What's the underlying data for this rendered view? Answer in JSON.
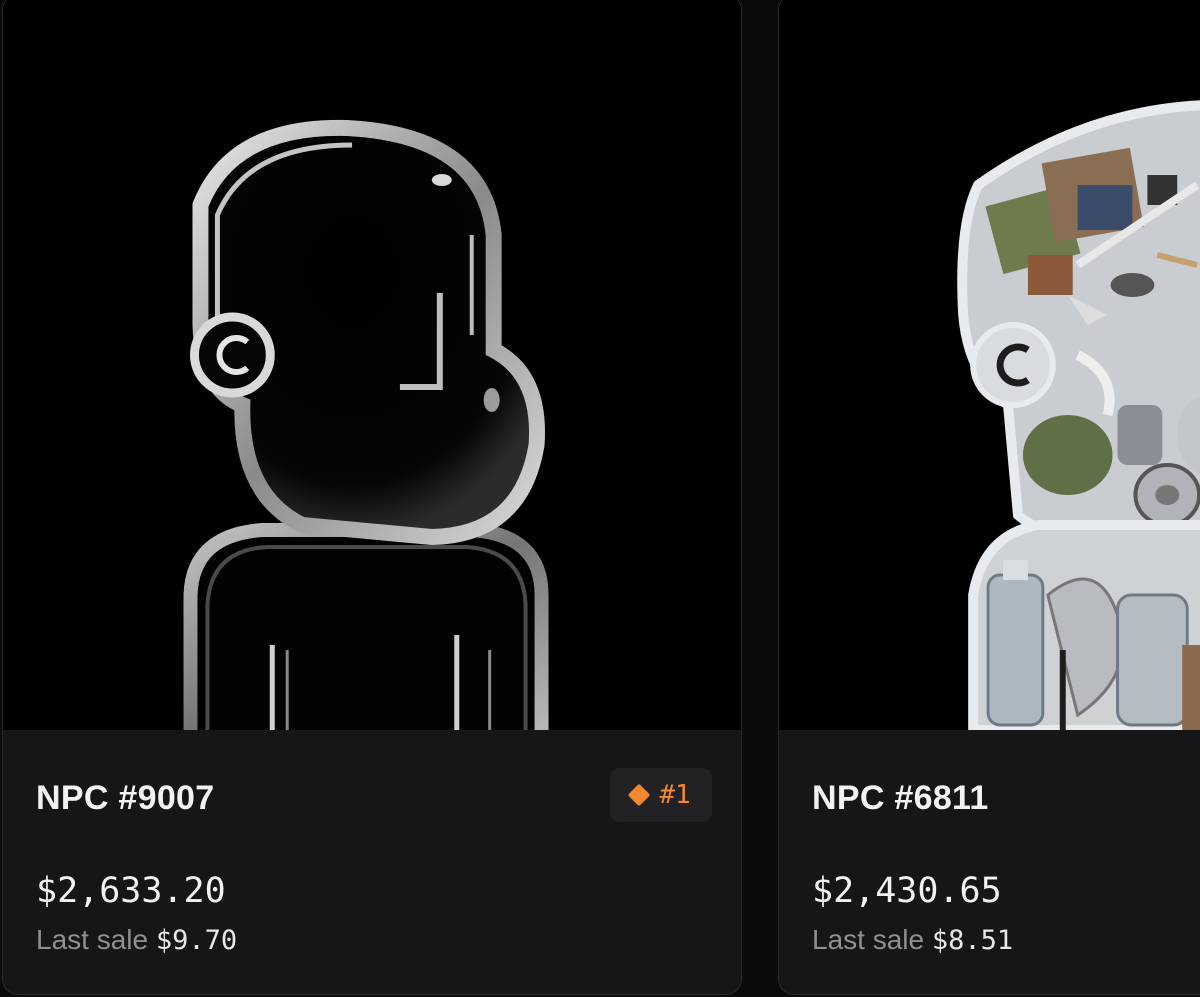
{
  "cards": [
    {
      "name": "NPC #9007",
      "rank": "#1",
      "price": "$2,633.20",
      "last_sale_label": "Last sale",
      "last_sale_value": "$9.70",
      "image": "transparent glass NPC figure"
    },
    {
      "name": "NPC #6811",
      "price": "$2,430.65",
      "last_sale_label": "Last sale",
      "last_sale_value": "$8.51",
      "image": "NPC figure filled with trash"
    }
  ],
  "colors": {
    "background": "#0b0b0c",
    "card": "#161618",
    "rank_accent": "#f2892e",
    "muted_text": "#8f8f95"
  },
  "icons": {
    "rank": "diamond-icon"
  }
}
